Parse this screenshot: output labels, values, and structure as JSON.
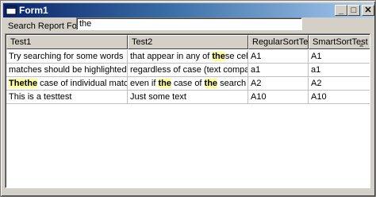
{
  "window": {
    "title": "Form1",
    "minimize": "_",
    "maximize": "□",
    "close": "✕"
  },
  "search": {
    "label": "Search Report For:",
    "value": "the"
  },
  "columns": [
    "Test1",
    "Test2",
    "RegularSortTest",
    "SmartSortTest"
  ],
  "sort_indicator": "▲",
  "rows": [
    {
      "c1": [
        {
          "t": "Try searching for some words"
        }
      ],
      "c2": [
        {
          "t": "that appear in any of "
        },
        {
          "t": "the",
          "hl": true
        },
        {
          "t": "se cells."
        }
      ],
      "c3": "A1",
      "c4": "A1"
    },
    {
      "c1": [
        {
          "t": "matches should be highlighted"
        }
      ],
      "c2": [
        {
          "t": "regardless of case (text compare sear"
        }
      ],
      "c3": "a1",
      "c4": "a1"
    },
    {
      "c1": [
        {
          "t": "The",
          "hl": true
        },
        {
          "t": "the",
          "hl": true
        },
        {
          "t": " case of individual matches sh"
        }
      ],
      "c2": [
        {
          "t": "even if "
        },
        {
          "t": "the",
          "hl": true
        },
        {
          "t": " case of "
        },
        {
          "t": "the",
          "hl": true
        },
        {
          "t": " search is diffe"
        }
      ],
      "c3": "A2",
      "c4": "A2"
    },
    {
      "c1": [
        {
          "t": "This is a testtest"
        }
      ],
      "c2": [
        {
          "t": "Just some text"
        }
      ],
      "c3": "A10",
      "c4": "A10"
    }
  ]
}
